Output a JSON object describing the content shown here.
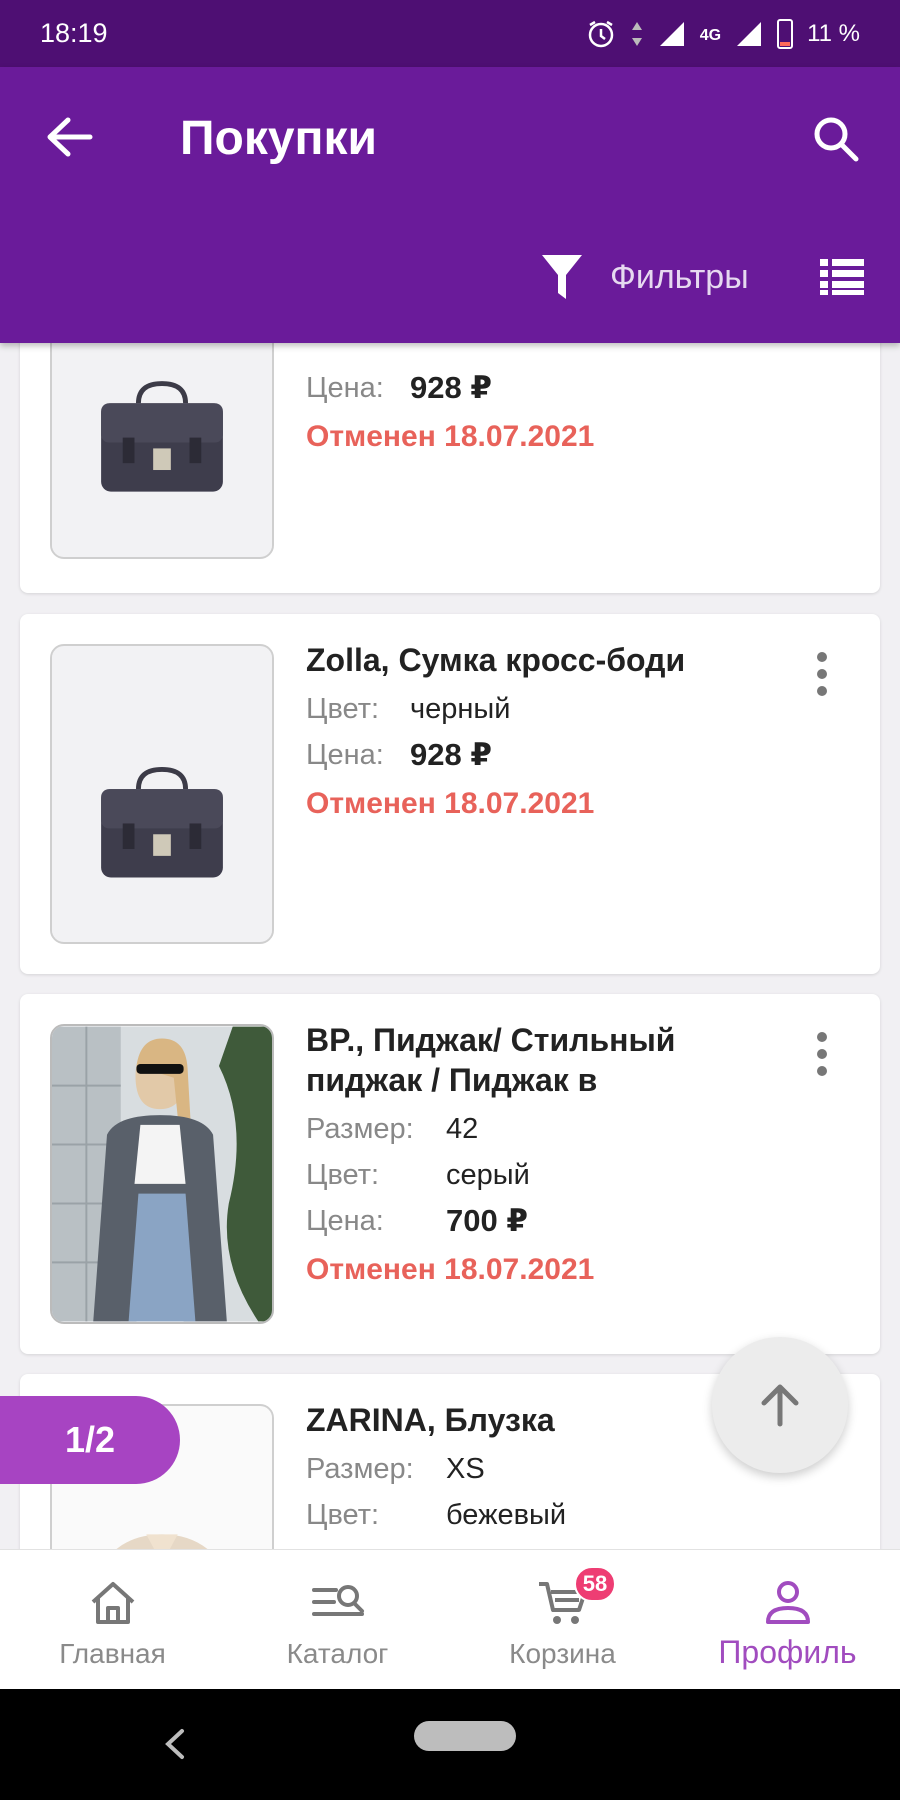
{
  "status_bar": {
    "time": "18:19",
    "network": "4G",
    "battery": "11 %"
  },
  "appbar": {
    "title": "Покупки",
    "filters_label": "Фильтры"
  },
  "orders": [
    {
      "title": "",
      "rows": [
        {
          "label": "Цена:",
          "value": "928 ₽"
        }
      ],
      "status": "Отменен 18.07.2021"
    },
    {
      "title": "Zolla, Сумка кросс-боди",
      "rows": [
        {
          "label": "Цвет:",
          "value": "черный"
        },
        {
          "label": "Цена:",
          "value": "928 ₽"
        }
      ],
      "status": "Отменен 18.07.2021"
    },
    {
      "title": "BP., Пиджак/ Стильный пиджак / Пиджак в",
      "rows": [
        {
          "label": "Размер:",
          "value": "42"
        },
        {
          "label": "Цвет:",
          "value": "серый"
        },
        {
          "label": "Цена:",
          "value": "700 ₽"
        }
      ],
      "status": "Отменен 18.07.2021"
    },
    {
      "title": "ZARINA, Блузка",
      "rows": [
        {
          "label": "Размер:",
          "value": "XS"
        },
        {
          "label": "Цвет:",
          "value": "бежевый"
        }
      ],
      "status": ""
    }
  ],
  "page_indicator": "1/2",
  "bottom_nav": {
    "items": [
      {
        "label": "Главная",
        "icon": "home-icon"
      },
      {
        "label": "Каталог",
        "icon": "catalog-search-icon"
      },
      {
        "label": "Корзина",
        "icon": "cart-icon",
        "badge": "58"
      },
      {
        "label": "Профиль",
        "icon": "profile-icon",
        "active": true
      }
    ]
  },
  "colors": {
    "primary": "#6a1b9a",
    "status_bar": "#4e0f73",
    "accent": "#a744c2",
    "cancelled": "#e8625a",
    "badge": "#ee3d73"
  }
}
